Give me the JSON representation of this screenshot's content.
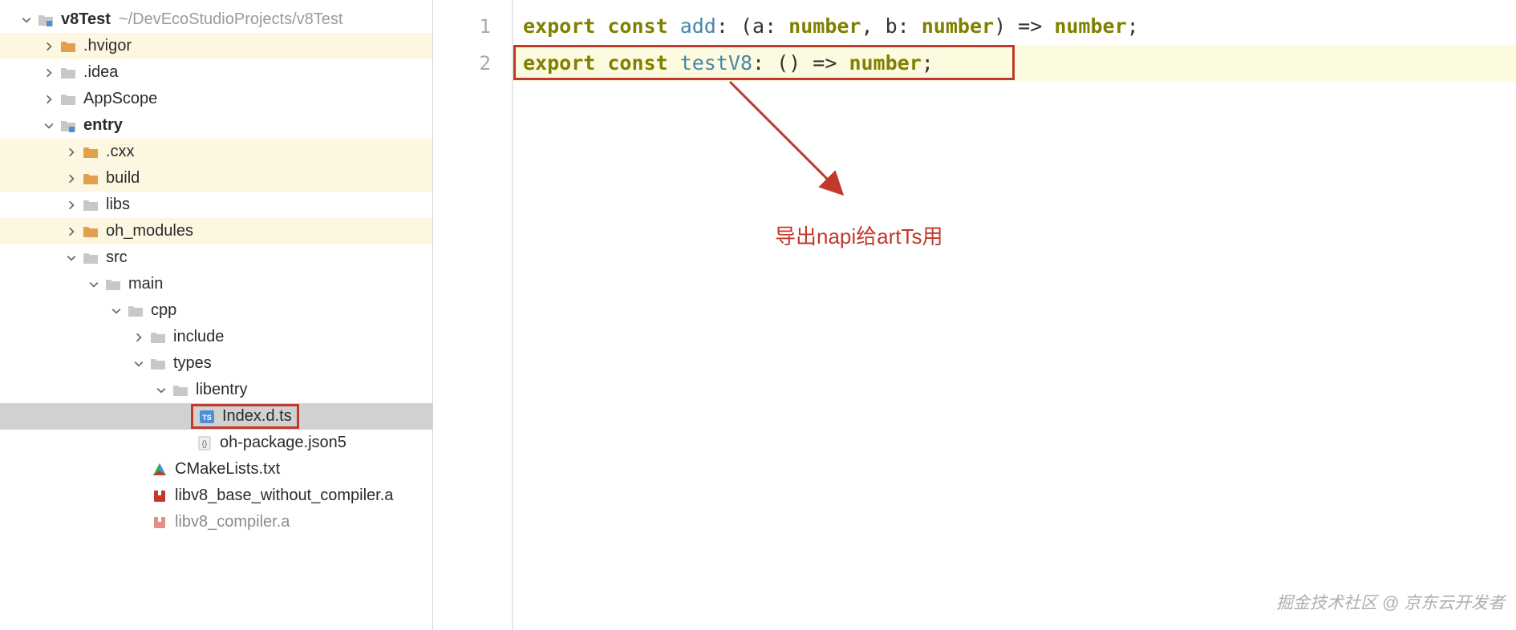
{
  "project": {
    "name": "v8Test",
    "path": "~/DevEcoStudioProjects/v8Test"
  },
  "tree": {
    "hvigor": ".hvigor",
    "idea": ".idea",
    "appscope": "AppScope",
    "entry": "entry",
    "cxx": ".cxx",
    "build": "build",
    "libs": "libs",
    "oh_modules": "oh_modules",
    "src": "src",
    "main": "main",
    "cpp": "cpp",
    "include": "include",
    "types": "types",
    "libentry": "libentry",
    "index_d_ts": "Index.d.ts",
    "oh_package": "oh-package.json5",
    "cmake": "CMakeLists.txt",
    "libv8_base": "libv8_base_without_compiler.a",
    "libv8_compiler": "libv8_compiler.a"
  },
  "code": {
    "line1": {
      "num": "1",
      "kw1": "export",
      "kw2": "const",
      "name": "add",
      "sig": ": (a: ",
      "type1": "number",
      "mid": ", b: ",
      "type2": "number",
      "close": ") => ",
      "ret": "number",
      "end": ";"
    },
    "line2": {
      "num": "2",
      "kw1": "export",
      "kw2": "const",
      "name": "testV8",
      "sig": ": () => ",
      "ret": "number",
      "end": ";"
    }
  },
  "annotation": "导出napi给artTs用",
  "watermark": "掘金技术社区 @ 京东云开发者"
}
